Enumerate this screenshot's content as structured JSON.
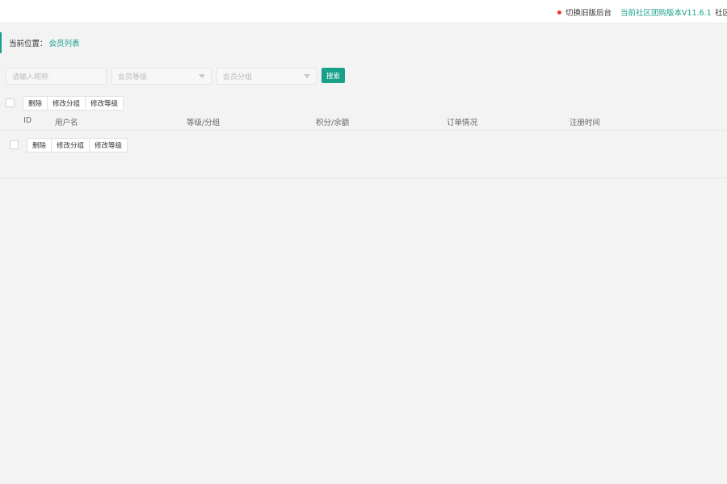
{
  "topbar": {
    "switch_old_label": "切换旧版后台",
    "version_label": "当前社区团购版本V11.6.1",
    "community_label": "社区"
  },
  "breadcrumb": {
    "label": "当前位置：",
    "current": "会员列表"
  },
  "filters": {
    "search_placeholder": "请输入昵称",
    "level_placeholder": "会员等级",
    "group_placeholder": "会员分组",
    "search_button": "搜索"
  },
  "batch_actions": {
    "delete": "删除",
    "change_group": "修改分组",
    "change_level": "修改等级"
  },
  "table": {
    "columns": [
      "ID",
      "用户名",
      "等级/分组",
      "积分/余额",
      "订单情况",
      "注册时间"
    ]
  },
  "colors": {
    "accent": "#18a08a",
    "dot": "#f0362f",
    "background": "#f3f3f3"
  }
}
